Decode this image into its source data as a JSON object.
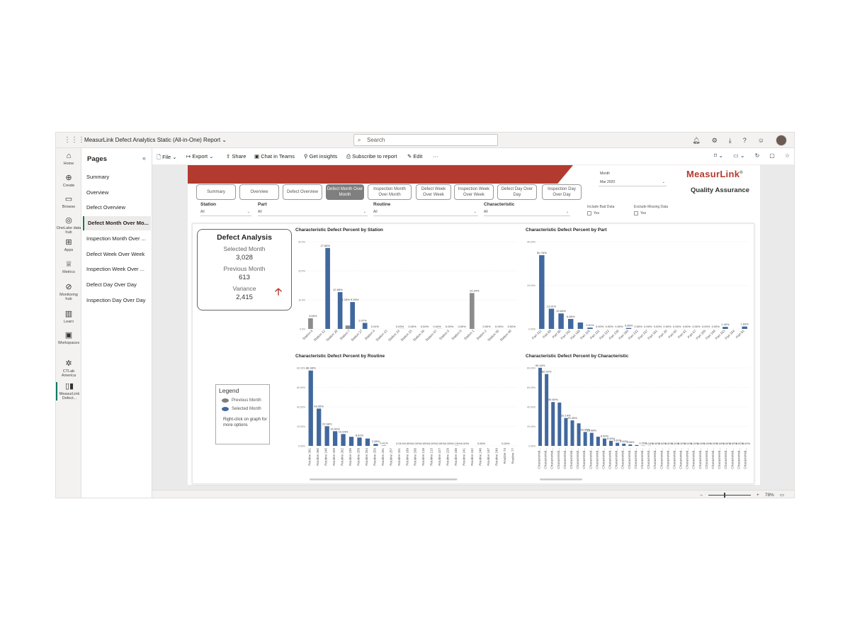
{
  "window": {
    "title": "MeasurLink Defect Analytics Static (All-in-One) Report",
    "search_placeholder": "Search"
  },
  "rail": [
    {
      "label": "Home",
      "icon": "home-icon",
      "glyph": "⌂"
    },
    {
      "label": "Create",
      "icon": "create-icon",
      "glyph": "⊕"
    },
    {
      "label": "Browse",
      "icon": "browse-icon",
      "glyph": "▭"
    },
    {
      "label": "OneLake data hub",
      "icon": "onelake-icon",
      "glyph": "◎"
    },
    {
      "label": "Apps",
      "icon": "apps-icon",
      "glyph": "⊞"
    },
    {
      "label": "Metrics",
      "icon": "metrics-icon",
      "glyph": "♕"
    },
    {
      "label": "Monitoring hub",
      "icon": "monitoring-icon",
      "glyph": "⊘"
    },
    {
      "label": "Learn",
      "icon": "learn-icon",
      "glyph": "▥"
    },
    {
      "label": "Workspaces",
      "icon": "workspaces-icon",
      "glyph": "▣"
    },
    {
      "label": "CTLab America",
      "icon": "workspace-icon",
      "glyph": "✲"
    },
    {
      "label": "MeasurLink Defect...",
      "icon": "report-icon",
      "glyph": "▯▮"
    }
  ],
  "pages": {
    "title": "Pages",
    "items": [
      "Summary",
      "Overview",
      "Defect Overview",
      "Defect Month Over Mo...",
      "Inspection Month Over ...",
      "Defect Week Over Week",
      "Inspection Week Over ...",
      "Defect Day Over Day",
      "Inspection Day Over Day"
    ]
  },
  "toolbar": {
    "file": "File",
    "export": "Export",
    "share": "Share",
    "chat": "Chat in Teams",
    "insights": "Get insights",
    "subscribe": "Subscribe to report",
    "edit": "Edit",
    "more": "···"
  },
  "report": {
    "month_label": "Month",
    "month_value": "Mar 2020",
    "logo": "MeasurLink",
    "logo_mark": "®",
    "logo_subtitle": "Quality Assurance",
    "nav": [
      {
        "label": "Summary"
      },
      {
        "label": "Overview"
      },
      {
        "label": "Defect Overview"
      },
      {
        "label": "Defect Month Over Month"
      },
      {
        "label": "Inspection Month Over Month"
      },
      {
        "label": "Defect Week Over Week"
      },
      {
        "label": "Inspection Week Over Week"
      },
      {
        "label": "Defect Day Over Day"
      },
      {
        "label": "Inspection Day Over Day"
      }
    ],
    "slicers": [
      {
        "label": "Station",
        "value": "All"
      },
      {
        "label": "Part",
        "value": "All"
      },
      {
        "label": "Routine",
        "value": "All"
      },
      {
        "label": "Characteristic",
        "value": "All"
      }
    ],
    "include_bad": {
      "label": "Include Bad Data",
      "option": "Yes"
    },
    "exclude_missing": {
      "label": "Exclude Missing Data",
      "option": "Yes"
    },
    "kpi": {
      "title": "Defect Analysis",
      "selected_label": "Selected Month",
      "selected_value": "3,028",
      "previous_label": "Previous Month",
      "previous_value": "613",
      "variance_label": "Variance",
      "variance_value": "2,415",
      "arrow": "🡡"
    },
    "legend": {
      "title": "Legend",
      "previous": "Previous Month",
      "selected": "Selected Month",
      "note": "Right-click on graph for more options",
      "previous_color": "#7f7f7f",
      "selected_color": "#41689e"
    }
  },
  "status": {
    "zoom": "78%"
  },
  "colors": {
    "accent": "#b33a2e",
    "selected": "#41689e",
    "previous": "#8c8c8c"
  },
  "chart_data": [
    {
      "type": "bar",
      "title": "Characteristic Defect Percent by Station",
      "ylim": [
        0,
        30
      ],
      "yticks": [
        "0.0%",
        "10.0%",
        "20.0%",
        "30.0%"
      ],
      "categories": [
        "Station 6",
        "Station 12",
        "Station 28",
        "Station 7",
        "Station 27",
        "Station 4",
        "Station 13",
        "Station 14",
        "Station 15",
        "Station 36",
        "Station 47",
        "Station 5",
        "Station 9",
        "Station 1",
        "Station 2",
        "Station 30",
        "Station 49"
      ],
      "series": [
        {
          "name": "Previous Month",
          "values": [
            3.65,
            0,
            0,
            1.18,
            0,
            0,
            0,
            0,
            0,
            0,
            0,
            0,
            0,
            12.34,
            0,
            0,
            0
          ]
        },
        {
          "name": "Selected Month",
          "values": [
            0,
            27.86,
            12.66,
            9.25,
            2.07,
            0.01,
            0,
            0.03,
            0,
            0,
            0.04,
            0,
            0,
            0,
            0,
            0,
            0
          ]
        }
      ],
      "labels": [
        "3.65%",
        "27.86%",
        "12.66%",
        "1.18% 9.25%",
        "2.07%",
        "0.01%",
        "",
        "0.03%",
        "0.00%",
        "0.00%",
        "0.04%",
        "0.00%",
        "0.00%",
        "12.34%",
        "0.00%",
        "0.00%",
        "0.00%"
      ]
    },
    {
      "type": "bar",
      "title": "Characteristic Defect Percent by Part",
      "ylim": [
        0,
        60
      ],
      "yticks": [
        "0.00%",
        "20.00%",
        "40.00%"
      ],
      "categories": [
        "Part 112",
        "Part 85",
        "Part 88",
        "Part 162",
        "Part 165",
        "Part 116",
        "Part 111",
        "Part 122",
        "Part 138",
        "Part 150",
        "Part 132",
        "Part 157",
        "Part 161",
        "Part 28",
        "Part 60",
        "Part 61",
        "Part 67",
        "Part 105",
        "Part 148",
        "Part 163",
        "Part 164",
        "Part 81"
      ],
      "series": [
        {
          "name": "Selected Month",
          "values": [
            50.76,
            13.91,
            10.64,
            6.86,
            4.42,
            0.91,
            0,
            0,
            0,
            0.65,
            0,
            0,
            0,
            0,
            0,
            0,
            0,
            0,
            0,
            1.4,
            0,
            1.63
          ]
        }
      ],
      "labels": [
        "50.76%",
        "13.91%",
        "10.64%",
        "6.86%",
        "",
        "0.91%",
        "0.00%",
        "0.00%",
        "0.00%",
        "0.65%",
        "0.00%",
        "0.00%",
        "0.00%",
        "0.00%",
        "0.00%",
        "0.00%",
        "0.00%",
        "0.00%",
        "0.00%",
        "1.40%",
        "",
        "1.63%"
      ]
    },
    {
      "type": "bar",
      "title": "Characteristic Defect Percent by Routine",
      "ylim": [
        0,
        90
      ],
      "yticks": [
        "0.00%",
        "20.00%",
        "40.00%",
        "60.00%",
        "80.00%"
      ],
      "categories": [
        "Routine 261",
        "Routine 260",
        "Routine 248",
        "Routine 259",
        "Routine 262",
        "Routine 239",
        "Routine 258",
        "Routine 254",
        "Routine 253",
        "Routine 251",
        "Routine 257",
        "Routine 201",
        "Routine 169",
        "Routine 208",
        "Routine 218",
        "Routine 213",
        "Routine 227",
        "Routine 229",
        "Routine 238",
        "Routine 241",
        "Routine 242",
        "Routine 246",
        "Routine 247",
        "Routine 249",
        "Routine 74",
        "Routine 77"
      ],
      "series": [
        {
          "name": "Selected Month",
          "values": [
            86.98,
            43.05,
            22.68,
            16.92,
            13.64,
            10.5,
            9.61,
            8.5,
            2.28,
            0.41,
            0,
            0.01,
            0,
            0,
            0,
            0,
            0,
            0,
            0.19,
            0,
            0,
            0,
            0,
            0,
            0,
            0
          ]
        }
      ],
      "labels": [
        "86.98%",
        "43.05%",
        "22.68%",
        "16.92%",
        "10.64%",
        "",
        "8.61%",
        "",
        "2.28%",
        "0.41%",
        "",
        "0.01%",
        "0.00%",
        "0.00%",
        "0.00%",
        "0.00%",
        "0.00%",
        "0.00%",
        "0.19%",
        "0.00%",
        "",
        "0.00%",
        "",
        "",
        "0.00%",
        ""
      ]
    },
    {
      "type": "bar",
      "title": "Characteristic Defect Percent by Characteristic",
      "ylim": [
        0,
        90
      ],
      "yticks": [
        "0.00%",
        "20.00%",
        "40.00%",
        "60.00%",
        "80.00%"
      ],
      "categories": [
        "Characteristi...",
        "Characteristi...",
        "Characteristi...",
        "Characteristi...",
        "Characteristi...",
        "Characteristi...",
        "Characteristi...",
        "Characteristi...",
        "Characteristi...",
        "Characteristi...",
        "Characteristi...",
        "Characteristi...",
        "Characteristi...",
        "Characteristi...",
        "Characteristi...",
        "Characteristi...",
        "Characteristi...",
        "Characteristi...",
        "Characteristi...",
        "Characteristi...",
        "Characteristi...",
        "Characteristi...",
        "Characteristi...",
        "Characteristi...",
        "Characteristi...",
        "Characteristi...",
        "Characteristi...",
        "Characteristi...",
        "Characteristi...",
        "Characteristi...",
        "Characteristi...",
        "Characteristi...",
        "Characteristi..."
      ],
      "series": [
        {
          "name": "Selected Month",
          "values": [
            90.15,
            82.92,
            50.6,
            50,
            32.14,
            29.45,
            26.05,
            16.05,
            15.08,
            10.6,
            8.5,
            5.9,
            3.6,
            2.6,
            1.65,
            1,
            0.29,
            0.16,
            0,
            0,
            0,
            0,
            0,
            0,
            0,
            0,
            0,
            0,
            0,
            0,
            0,
            0,
            0
          ]
        }
      ],
      "labels": [
        "90.15%",
        "82.92%",
        "50.60%",
        "",
        "32.14%",
        "29.45%",
        "",
        "16.05%",
        "15.08%",
        "",
        "8.50%",
        "5.90%",
        "3.60%",
        "2.60%",
        "1.65%",
        "",
        "0.29%",
        "0.16%",
        "0.00%",
        "0.00%",
        "0.00%",
        "0.00%",
        "0.00%",
        "0.00%",
        "0.00%",
        "0.00%",
        "0.00%",
        "0.00%",
        "0.00%",
        "0.00%",
        "0.00%",
        "0.00%",
        "0.00%"
      ]
    }
  ]
}
